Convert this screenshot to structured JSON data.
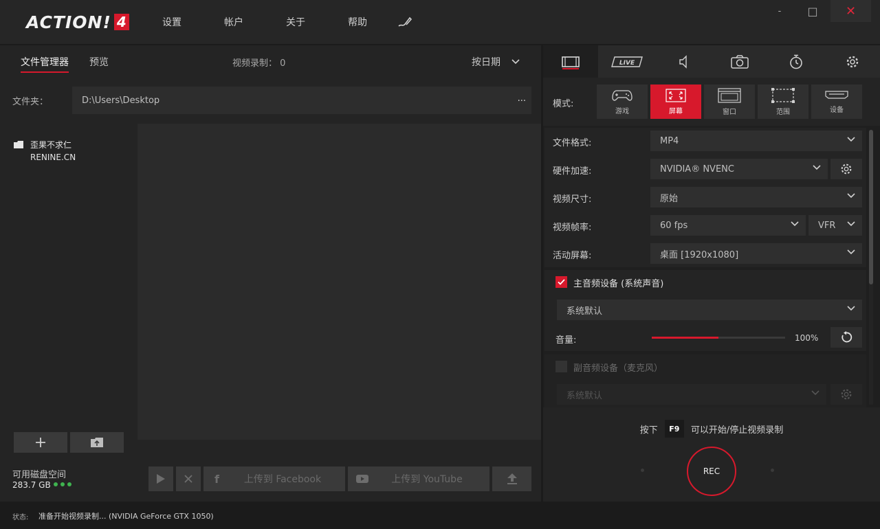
{
  "app": {
    "logo_text": "ACTION!",
    "logo_badge": "4"
  },
  "menu": {
    "settings": "设置",
    "account": "帐户",
    "about": "关于",
    "help": "帮助"
  },
  "window": {
    "minimize": "-",
    "maximize": "□",
    "close": "✕"
  },
  "left": {
    "tabs": {
      "file_manager": "文件管理器",
      "preview": "预览"
    },
    "video_count_label": "视频录制：",
    "video_count": "0",
    "sort_label": "按日期",
    "folder_label": "文件夹：",
    "folder_path": "D:\\Users\\Desktop",
    "folder_more": "...",
    "tree": {
      "line1": "歪果不求仁",
      "line2": "RENINE.CN"
    },
    "disk_label": "可用磁盘空间",
    "disk_value": "283.7 GB",
    "upload_facebook": "上传到 Facebook",
    "upload_youtube": "上传到 YouTube"
  },
  "right": {
    "mode_label": "模式:",
    "modes": [
      "游戏",
      "屏幕",
      "窗口",
      "范围",
      "设备"
    ],
    "file_format_label": "文件格式:",
    "file_format": "MP4",
    "hw_accel_label": "硬件加速:",
    "hw_accel": "NVIDIA® NVENC",
    "video_size_label": "视频尺寸:",
    "video_size": "原始",
    "framerate_label": "视频帧率:",
    "framerate": "60 fps",
    "framerate_mode": "VFR",
    "active_screen_label": "活动屏幕:",
    "active_screen": "桌面 [1920x1080]",
    "main_audio_label": "主音频设备 (系统声音)",
    "main_audio_device": "系统默认",
    "volume_label": "音量:",
    "volume_value": "100%",
    "volume_fraction": 1.0,
    "secondary_audio_label": "副音频设备（麦克风）",
    "secondary_audio_device": "系统默认",
    "hotkey_prefix": "按下",
    "hotkey_key": "F9",
    "hotkey_suffix": "可以开始/停止视频录制",
    "rec_label": "REC"
  },
  "status": {
    "label": "状态:",
    "text": "准备开始视频录制... (NVIDIA GeForce GTX 1050)"
  },
  "colors": {
    "accent": "#d7192c",
    "disk_ok": "#3fb34f"
  }
}
